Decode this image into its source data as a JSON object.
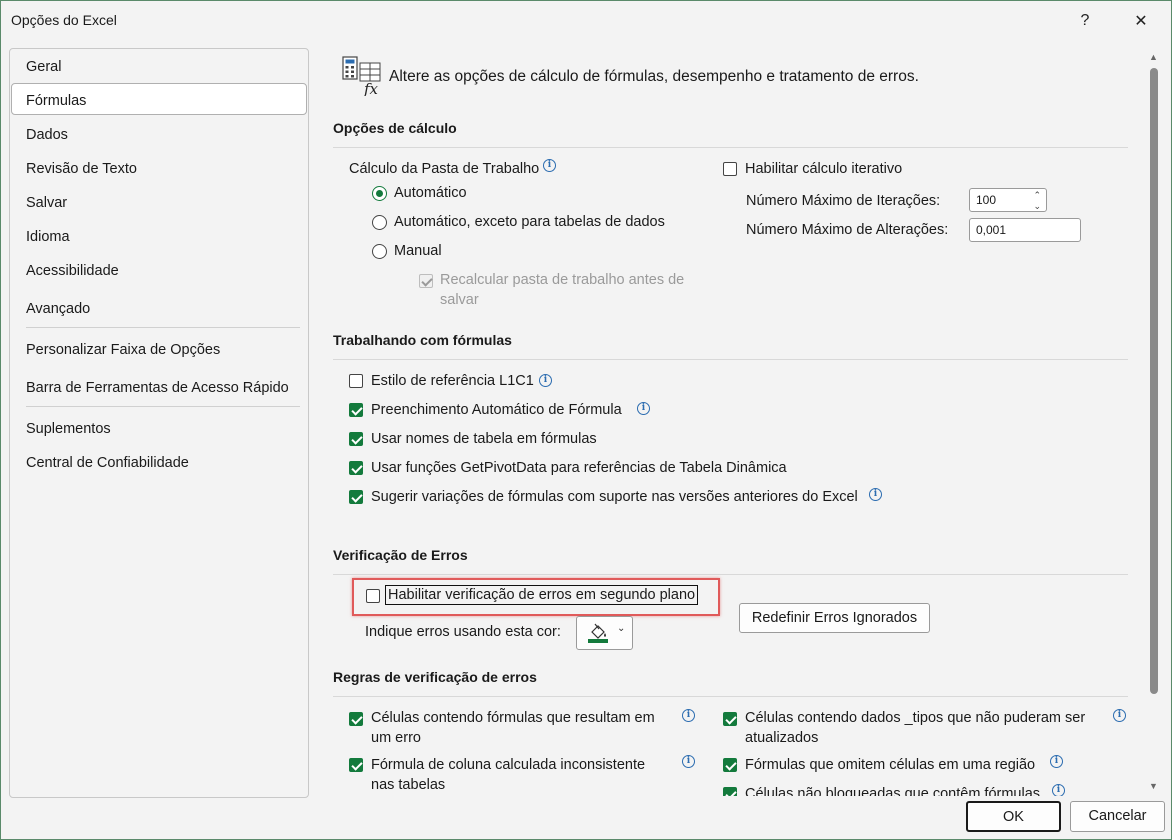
{
  "window": {
    "title": "Opções do Excel",
    "help_label": "?",
    "close_label": "✕"
  },
  "sidebar": {
    "items": [
      {
        "label": "Geral"
      },
      {
        "label": "Fórmulas",
        "selected": true
      },
      {
        "label": "Dados"
      },
      {
        "label": "Revisão de Texto"
      },
      {
        "label": "Salvar"
      },
      {
        "label": "Idioma"
      },
      {
        "label": "Acessibilidade"
      },
      {
        "label": "Avançado"
      },
      {
        "label": "Personalizar Faixa de Opções"
      },
      {
        "label": "Barra de Ferramentas de Acesso Rápido"
      },
      {
        "label": "Suplementos"
      },
      {
        "label": "Central de Confiabilidade"
      }
    ]
  },
  "header": {
    "icon": "formula-calculator-icon",
    "description": "Altere as opções de cálculo de fórmulas, desempenho e tratamento de erros."
  },
  "calc": {
    "title": "Opções de cálculo",
    "workbook_label": "Cálculo da Pasta de Trabalho",
    "options": [
      {
        "label": "Automático",
        "checked": true
      },
      {
        "label": "Automático, exceto para tabelas de dados",
        "checked": false
      },
      {
        "label": "Manual",
        "checked": false
      }
    ],
    "recalc_line1": "Recalcular pasta de trabalho antes de",
    "recalc_line2": "salvar",
    "iterative_label": "Habilitar cálculo iterativo",
    "max_iter_label": "Número Máximo de Iterações:",
    "max_iter_value": "100",
    "max_change_label": "Número Máximo de Alterações:",
    "max_change_value": "0,001"
  },
  "formulas": {
    "title": "Trabalhando com fórmulas",
    "items": [
      {
        "label": "Estilo de referência L1C1",
        "checked": false
      },
      {
        "label": "Preenchimento Automático de Fórmula",
        "checked": true
      },
      {
        "label": "Usar nomes de tabela em fórmulas",
        "checked": true
      },
      {
        "label": "Usar funções GetPivotData para referências de Tabela Dinâmica",
        "checked": true
      },
      {
        "label": "Sugerir variações de fórmulas com suporte nas versões anteriores do Excel",
        "checked": true
      }
    ]
  },
  "errors": {
    "title": "Verificação de Erros",
    "background_label": "Habilitar verificação de erros em segundo plano",
    "background_checked": false,
    "indicate_label": "Indique erros usando esta cor:",
    "reset_label": "Redefinir Erros Ignorados",
    "highlight_color": "#e05a5a",
    "indicator_color": "#137a3c"
  },
  "rules": {
    "title": "Regras de verificação de erros",
    "left": [
      {
        "line1": "Células contendo fórmulas que resultam em",
        "line2": "um erro",
        "checked": true
      },
      {
        "line1": "Fórmula de coluna calculada inconsistente",
        "line2": "nas tabelas",
        "checked": true
      }
    ],
    "right": [
      {
        "line1": "Células contendo dados _tipos que não puderam ser",
        "line2": "atualizados",
        "checked": true
      },
      {
        "line1": "Fórmulas que omitem células em uma região",
        "line2": "",
        "checked": true
      },
      {
        "line1": "Células não bloqueadas que contêm fórmulas",
        "line2": "",
        "checked": true
      }
    ]
  },
  "footer": {
    "ok_label": "OK",
    "cancel_label": "Cancelar"
  },
  "colors": {
    "accent": "#137a3c",
    "info": "#2b6cb0"
  }
}
